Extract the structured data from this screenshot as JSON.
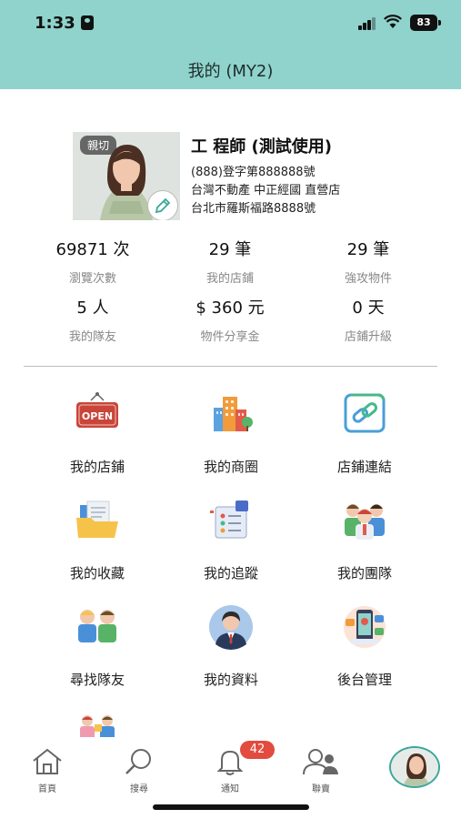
{
  "status_bar": {
    "time": "1:33",
    "battery": "83"
  },
  "header": {
    "title": "我的 (MY2)"
  },
  "profile": {
    "photo_tag": "親切",
    "name": "工 程師 (測試使用)",
    "license": "(888)登字第888888號",
    "company": "台灣不動產 中正經國 直營店",
    "address": "台北市羅斯福路8888號"
  },
  "stats": [
    {
      "value": "69871 次",
      "label": "瀏覽次數"
    },
    {
      "value": "29 筆",
      "label": "我的店鋪"
    },
    {
      "value": "29 筆",
      "label": "強攻物件"
    },
    {
      "value": "5 人",
      "label": "我的隊友"
    },
    {
      "value": "$ 360 元",
      "label": "物件分享金"
    },
    {
      "value": "0 天",
      "label": "店鋪升級"
    }
  ],
  "menu": [
    {
      "label": "我的店鋪",
      "icon": "open-sign-icon",
      "icon_text": "OPEN"
    },
    {
      "label": "我的商圈",
      "icon": "buildings-icon"
    },
    {
      "label": "店鋪連結",
      "icon": "link-icon"
    },
    {
      "label": "我的收藏",
      "icon": "folder-icon"
    },
    {
      "label": "我的追蹤",
      "icon": "tracking-board-icon"
    },
    {
      "label": "我的團隊",
      "icon": "team-icon"
    },
    {
      "label": "尋找隊友",
      "icon": "find-teammates-icon"
    },
    {
      "label": "我的資料",
      "icon": "profile-icon"
    },
    {
      "label": "後台管理",
      "icon": "admin-icon"
    },
    {
      "label": "",
      "icon": "partially-visible-icon"
    }
  ],
  "bottom_nav": {
    "items": [
      {
        "label": "首頁",
        "icon": "home-icon"
      },
      {
        "label": "搜尋",
        "icon": "search-icon"
      },
      {
        "label": "通知",
        "icon": "bell-icon"
      },
      {
        "label": "聯賣",
        "icon": "people-icon"
      }
    ],
    "notification_count": "42"
  },
  "colors": {
    "header_bg": "#8fd3cc",
    "badge_red": "#e24b3f",
    "avatar_ring": "#3aa79b"
  }
}
